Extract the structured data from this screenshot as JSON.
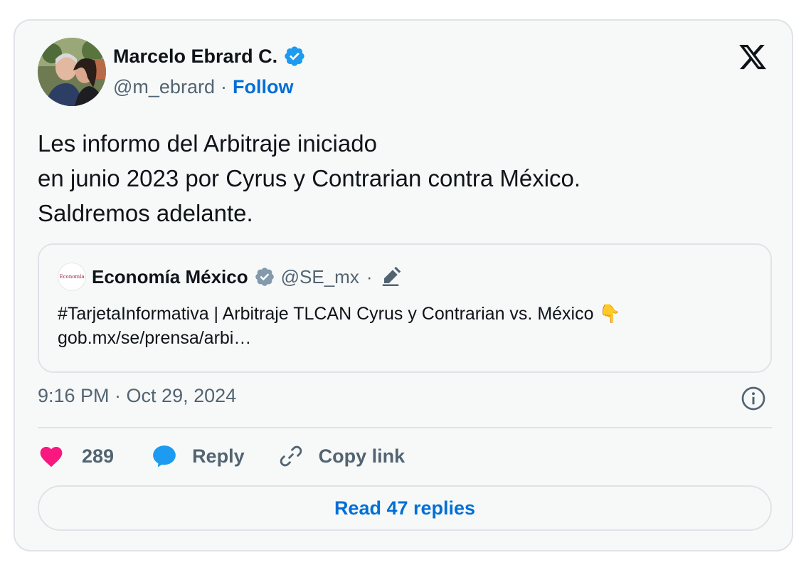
{
  "author": {
    "display_name": "Marcelo Ebrard C.",
    "handle": "@m_ebrard",
    "separator": "·",
    "follow_label": "Follow",
    "verified": true
  },
  "tweet": {
    "lines": [
      "Les informo del Arbitraje iniciado",
      "en junio 2023 por Cyrus y Contrarian contra México.",
      "Saldremos adelante."
    ],
    "timestamp": "9:16 PM · Oct 29, 2024"
  },
  "quoted": {
    "avatar_text": "Economía",
    "display_name": "Economía México",
    "handle": "@SE_mx",
    "separator": "·",
    "text_line_1": "#TarjetaInformativa | Arbitraje TLCAN Cyrus y Contrarian vs. México 👇",
    "text_line_2": "gob.mx/se/prensa/arbi…"
  },
  "actions": {
    "like_count": "289",
    "reply_label": "Reply",
    "copy_link_label": "Copy link",
    "read_replies_label": "Read 47 replies"
  },
  "colors": {
    "verified_blue": "#1d9bf0",
    "link_blue": "#006fd6",
    "like_pink": "#f91880",
    "text_dark": "#0f1419",
    "text_gray": "#536471",
    "border": "#dfe3e7",
    "card_bg": "#f7f9f9"
  },
  "icons": {
    "brand": "x-logo-icon",
    "verified": "verified-badge-icon",
    "org_verified": "gray-verified-badge-icon",
    "edited": "pen-icon",
    "info": "info-icon",
    "like": "heart-icon",
    "reply": "speech-bubble-icon",
    "copy_link": "link-icon"
  }
}
